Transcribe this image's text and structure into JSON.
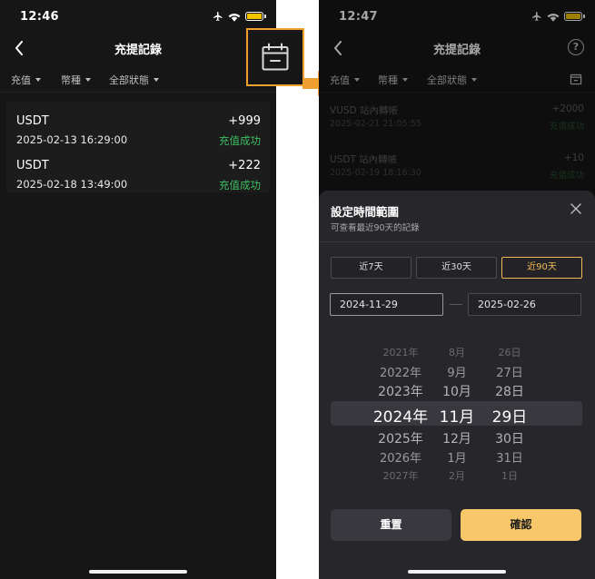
{
  "left": {
    "status": {
      "time": "12:46"
    },
    "nav": {
      "title": "充提記錄"
    },
    "filters": [
      "充值",
      "幣種",
      "全部狀態"
    ],
    "records": [
      {
        "coin": "USDT",
        "time": "2025-02-13 16:29:00",
        "amount": "+999",
        "status": "充值成功"
      },
      {
        "coin": "USDT",
        "time": "2025-02-18 13:49:00",
        "amount": "+222",
        "status": "充值成功"
      }
    ]
  },
  "right": {
    "status": {
      "time": "12:47"
    },
    "nav": {
      "title": "充提記錄",
      "help": "?"
    },
    "filters": [
      "充值",
      "幣種",
      "全部狀態"
    ],
    "records": [
      {
        "coin": "VUSD 站內轉帳",
        "time": "2025-02-21 21:05:55",
        "amount": "+2000",
        "status": "充值成功"
      },
      {
        "coin": "USDT 站內轉帳",
        "time": "2025-02-19 18:16:30",
        "amount": "+10",
        "status": "充值成功"
      }
    ],
    "sheet": {
      "title": "設定時間範圍",
      "subtitle": "可查看最近90天的記錄",
      "presets": [
        "近7天",
        "近30天",
        "近90天"
      ],
      "active_preset": 2,
      "start_date": "2024-11-29",
      "end_date": "2025-02-26",
      "picker": {
        "years": [
          "2021年",
          "2022年",
          "2023年",
          "2024年",
          "2025年",
          "2026年",
          "2027年"
        ],
        "months": [
          "8月",
          "9月",
          "10月",
          "11月",
          "12月",
          "1月",
          "2月"
        ],
        "days": [
          "26日",
          "27日",
          "28日",
          "29日",
          "30日",
          "31日",
          "1日"
        ]
      },
      "reset_label": "重置",
      "confirm_label": "確認"
    }
  },
  "colors": {
    "background": "#161616",
    "success": "#3fbf62",
    "accent": "#f7c76a",
    "highlight": "#f0a030"
  }
}
